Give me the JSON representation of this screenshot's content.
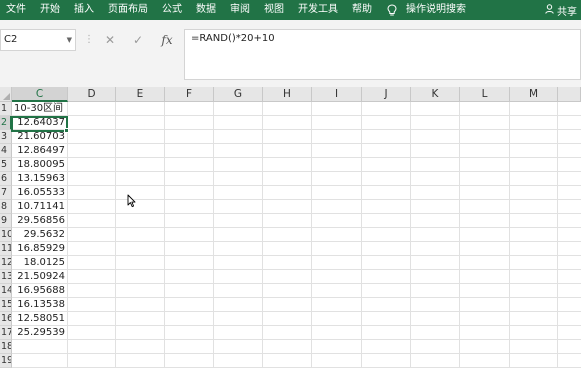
{
  "ribbon": {
    "menu": [
      "文件",
      "开始",
      "插入",
      "页面布局",
      "公式",
      "数据",
      "审阅",
      "视图",
      "开发工具",
      "帮助"
    ],
    "tell_me": "操作说明搜索",
    "share": "共享",
    "accent": "#217346"
  },
  "formula_bar": {
    "name_box": "C2",
    "formula": "=RAND()*20+10",
    "cancel_icon": "x-icon",
    "enter_icon": "check-icon",
    "fx_label": "fx"
  },
  "columns": [
    "C",
    "D",
    "E",
    "F",
    "G",
    "H",
    "I",
    "J",
    "K",
    "L",
    "M"
  ],
  "rows": [
    "1",
    "2",
    "3",
    "4",
    "5",
    "6",
    "7",
    "8",
    "9",
    "10",
    "11",
    "12",
    "13",
    "14",
    "15",
    "16",
    "17",
    "18",
    "19"
  ],
  "column_c": {
    "header_cell": "10-30区间",
    "values": [
      "12.64037",
      "21.60703",
      "12.86497",
      "18.80095",
      "13.15963",
      "16.05533",
      "10.71141",
      "29.56856",
      "29.5632",
      "16.85929",
      "18.0125",
      "21.50924",
      "16.95688",
      "16.13538",
      "12.58051",
      "25.29539"
    ]
  },
  "selected_cell": "C2"
}
